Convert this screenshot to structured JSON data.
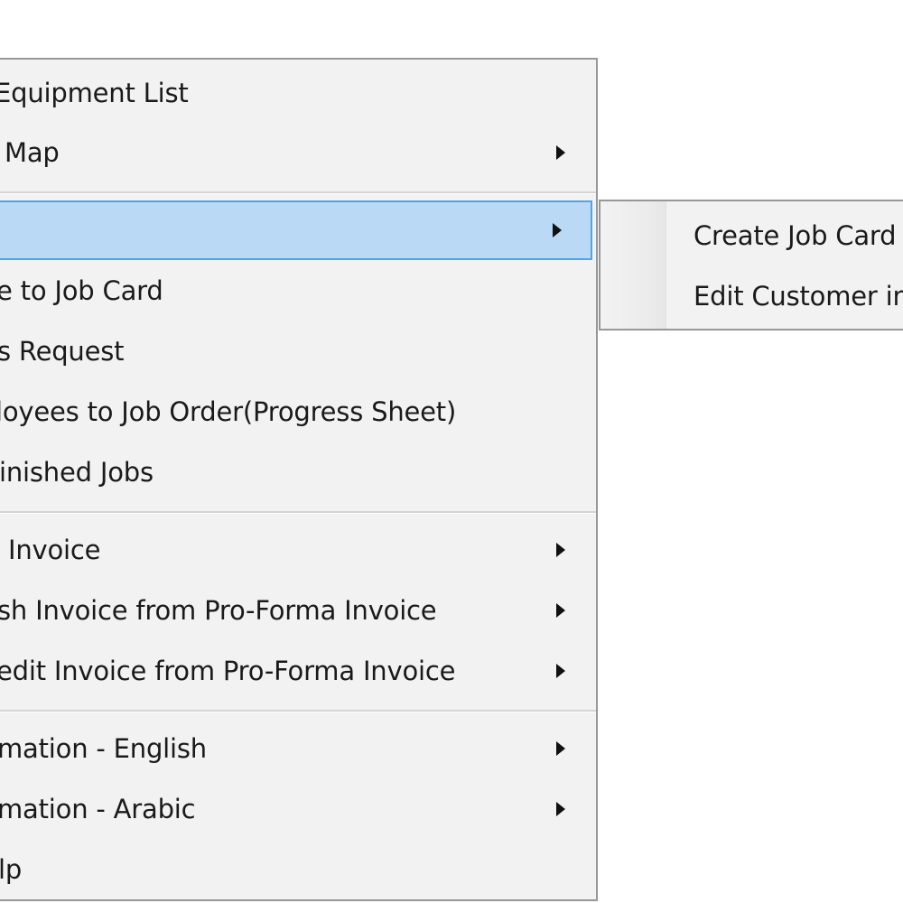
{
  "context_menu": {
    "items": [
      {
        "label": "Equipment List",
        "has_submenu": false
      },
      {
        "label": "Map",
        "has_submenu": true
      },
      {
        "label": "",
        "has_submenu": true,
        "highlighted": true
      },
      {
        "label": "e to Job Card",
        "has_submenu": false
      },
      {
        "label": "s Request",
        "has_submenu": false
      },
      {
        "label": "loyees to Job Order(Progress Sheet)",
        "has_submenu": false
      },
      {
        "label": "inished Jobs",
        "has_submenu": false
      },
      {
        "label": "Invoice",
        "has_submenu": true
      },
      {
        "label": "sh Invoice from Pro-Forma Invoice",
        "has_submenu": true
      },
      {
        "label": "edit Invoice from Pro-Forma Invoice",
        "has_submenu": true
      },
      {
        "label": "mation - English",
        "has_submenu": true
      },
      {
        "label": "mation - Arabic",
        "has_submenu": true
      },
      {
        "label": "lp",
        "has_submenu": false
      }
    ]
  },
  "submenu": {
    "items": [
      {
        "label": "Create Job Card"
      },
      {
        "label": "Edit Customer in"
      }
    ]
  },
  "colors": {
    "menu_background": "#f2f2f2",
    "highlight_fill": "#b9d9f5",
    "highlight_border": "#4fa3e8",
    "border": "#979797"
  }
}
